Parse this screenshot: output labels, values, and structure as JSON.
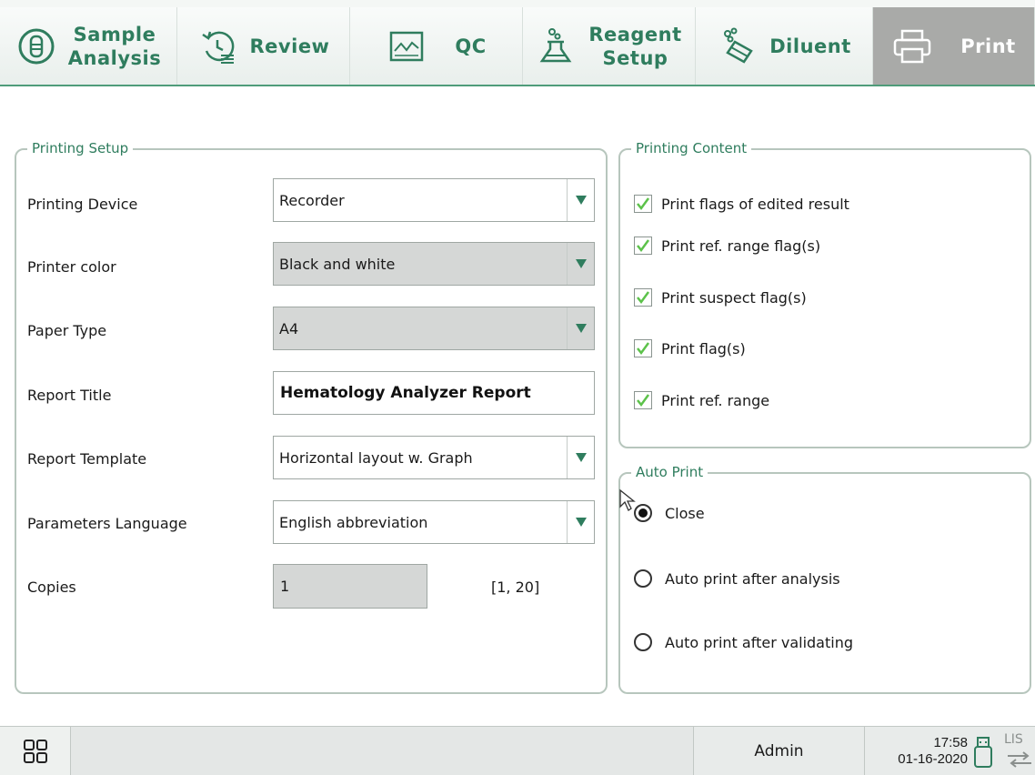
{
  "tabs": [
    {
      "label_line1": "Sample",
      "label_line2": "Analysis",
      "icon": "sample-analysis-icon"
    },
    {
      "label_line1": "Review",
      "label_line2": "",
      "icon": "review-icon"
    },
    {
      "label_line1": "QC",
      "label_line2": "",
      "icon": "qc-icon"
    },
    {
      "label_line1": "Reagent",
      "label_line2": "Setup",
      "icon": "reagent-flask-icon"
    },
    {
      "label_line1": "Diluent",
      "label_line2": "",
      "icon": "diluent-icon"
    },
    {
      "label_line1": "Print",
      "label_line2": "",
      "icon": "printer-icon"
    }
  ],
  "printing_setup": {
    "title": "Printing Setup",
    "printing_device": {
      "label": "Printing Device",
      "value": "Recorder"
    },
    "printer_color": {
      "label": "Printer color",
      "value": "Black and white"
    },
    "paper_type": {
      "label": "Paper Type",
      "value": "A4"
    },
    "report_title": {
      "label": "Report Title",
      "value": "Hematology Analyzer Report"
    },
    "report_template": {
      "label": "Report Template",
      "value": "Horizontal layout w. Graph"
    },
    "parameters_language": {
      "label": "Parameters Language",
      "value": "English abbreviation"
    },
    "copies": {
      "label": "Copies",
      "value": "1",
      "range": "[1, 20]"
    }
  },
  "printing_content": {
    "title": "Printing Content",
    "items": [
      {
        "label": "Print flags of edited result",
        "checked": true
      },
      {
        "label": "Print ref. range flag(s)",
        "checked": true
      },
      {
        "label": "Print suspect flag(s)",
        "checked": true
      },
      {
        "label": "Print flag(s)",
        "checked": true
      },
      {
        "label": "Print ref. range",
        "checked": true
      }
    ]
  },
  "auto_print": {
    "title": "Auto Print",
    "options": [
      {
        "label": "Close",
        "selected": true
      },
      {
        "label": "Auto print after analysis",
        "selected": false
      },
      {
        "label": "Auto print after validating",
        "selected": false
      }
    ]
  },
  "status_bar": {
    "user": "Admin",
    "time": "17:58",
    "date": "01-16-2020",
    "lis": "LIS"
  },
  "colors": {
    "accent": "#2f7d5e",
    "check": "#5cc24a",
    "active_tab": "#a9aaa8"
  }
}
